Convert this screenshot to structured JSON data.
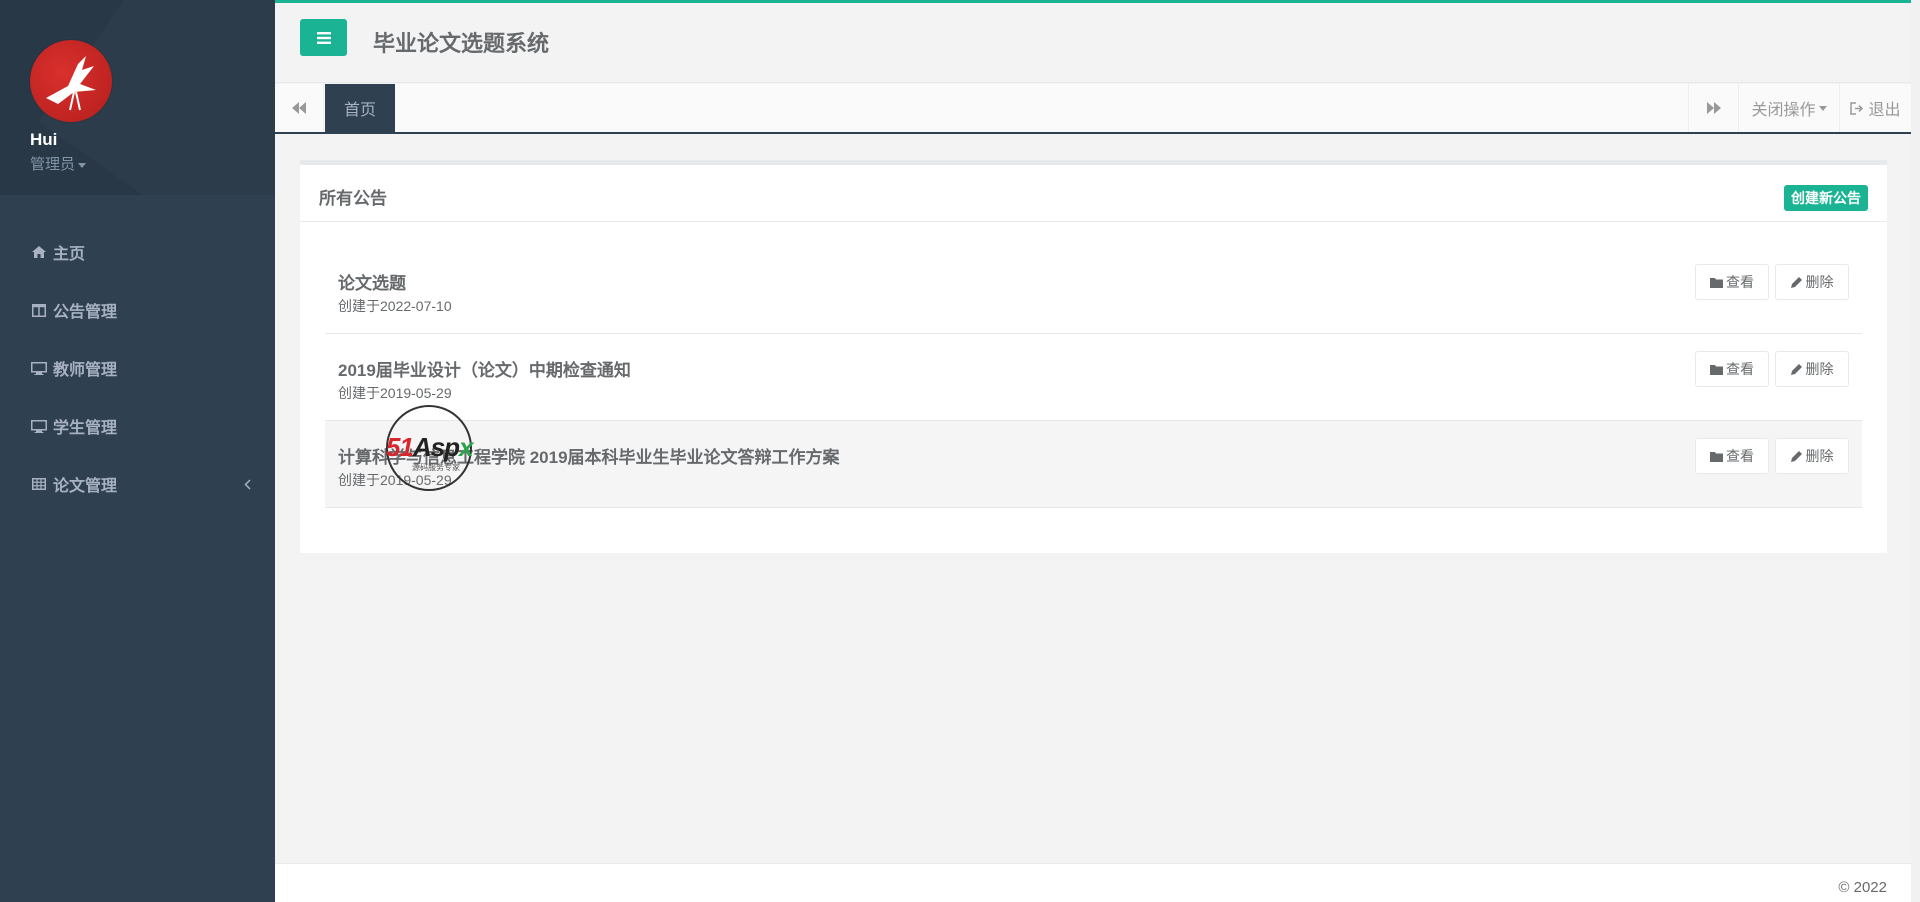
{
  "sidebar": {
    "user_name": "Hui",
    "user_role": "管理员",
    "items": [
      {
        "label": "主页",
        "icon": "home-icon"
      },
      {
        "label": "公告管理",
        "icon": "columns-icon"
      },
      {
        "label": "教师管理",
        "icon": "desktop-icon"
      },
      {
        "label": "学生管理",
        "icon": "desktop-icon"
      },
      {
        "label": "论文管理",
        "icon": "table-icon"
      }
    ]
  },
  "header": {
    "title": "毕业论文选题系统"
  },
  "tabs": {
    "home": "首页",
    "close_ops": "关闭操作",
    "logout": "退出"
  },
  "announcements": {
    "title": "所有公告",
    "create_label": "创建新公告",
    "view_label": "查看",
    "delete_label": "删除",
    "items": [
      {
        "title": "论文选题",
        "date": "创建于2022-07-10"
      },
      {
        "title": "2019届毕业设计（论文）中期检查通知",
        "date": "创建于2019-05-29"
      },
      {
        "title": "计算科学与信息工程学院 2019届本科毕业生毕业论文答辩工作方案",
        "date": "创建于2019-05-29"
      }
    ]
  },
  "watermark": {
    "a": "51",
    "b": "Asp",
    "c": "x",
    "sub": "源码服务专家"
  },
  "footer": {
    "copyright": "© 2022"
  },
  "colors": {
    "accent": "#1ab394",
    "sidebar": "#2f4050",
    "text": "#676a6c"
  }
}
